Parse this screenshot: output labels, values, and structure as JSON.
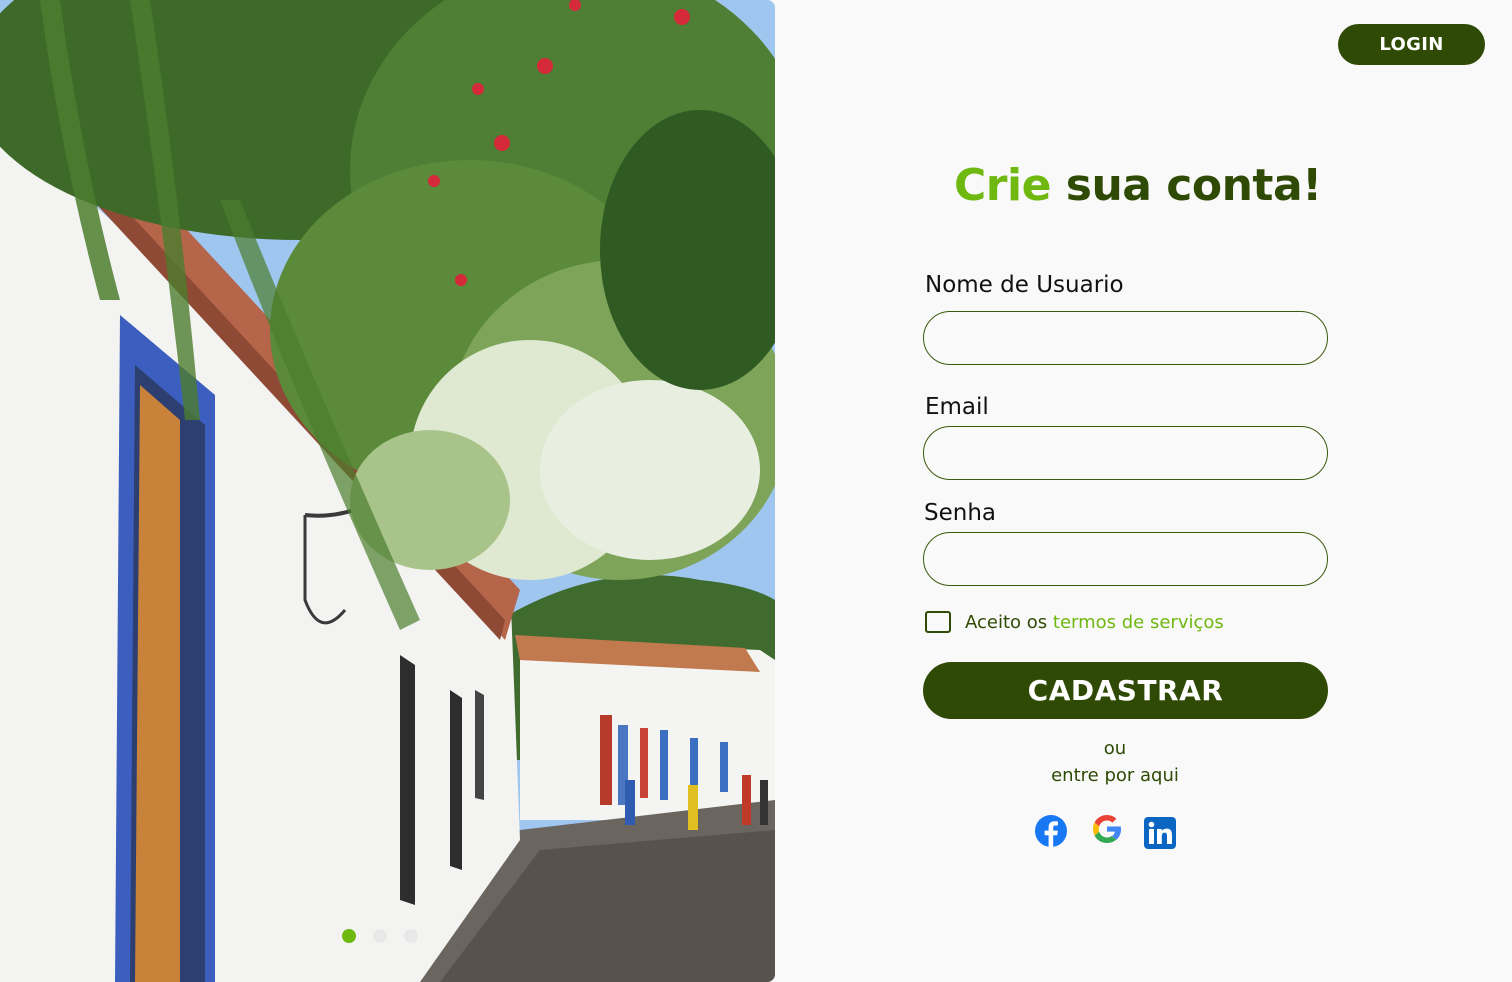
{
  "header": {
    "login_label": "LOGIN"
  },
  "hero": {
    "image": "street-with-colonial-houses-and-bougainvillea",
    "carousel": {
      "count": 3,
      "active_index": 0
    }
  },
  "form": {
    "title_accent": "Crie",
    "title_rest": "sua conta!",
    "username_label": "Nome de Usuario",
    "username_value": "",
    "email_label": "Email",
    "email_value": "",
    "password_label": "Senha",
    "password_value": "",
    "terms_prefix": "Aceito os",
    "terms_link": "termos de serviços",
    "terms_checked": false,
    "submit_label": "CADASTRAR",
    "or_label": "ou",
    "alt_label": "entre por aqui"
  },
  "social": [
    {
      "name": "facebook-icon",
      "color": "#1877f2"
    },
    {
      "name": "google-icon",
      "color": "#4285f4"
    },
    {
      "name": "linkedin-icon",
      "color": "#0a66c2"
    }
  ],
  "colors": {
    "primary": "#2f4a04",
    "accent": "#6fb810",
    "background": "#f9f9f9"
  }
}
